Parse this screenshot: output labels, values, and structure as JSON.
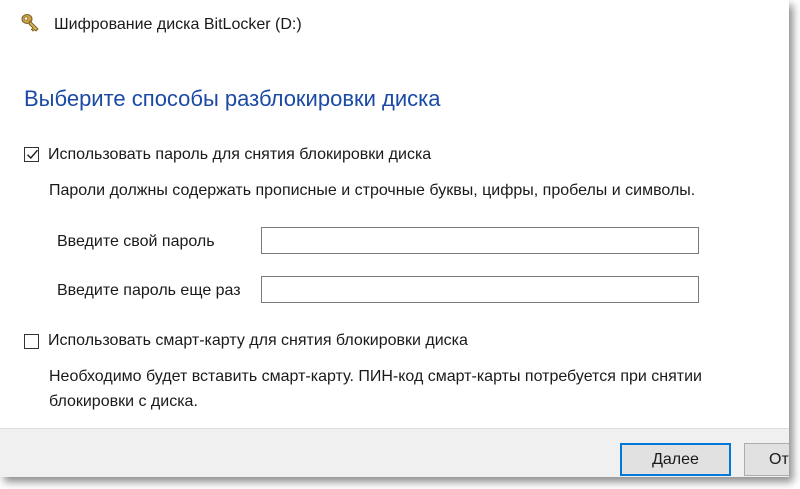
{
  "window": {
    "title": "Шифрование диска BitLocker (D:)",
    "icon": "bitlocker-key-icon"
  },
  "heading": "Выберите способы разблокировки диска",
  "password_option": {
    "checked": true,
    "label": "Использовать пароль для снятия блокировки диска",
    "description": "Пароли должны содержать прописные и строчные буквы, цифры, пробелы и символы.",
    "fields": [
      {
        "label": "Введите свой пароль",
        "value": ""
      },
      {
        "label": "Введите пароль еще раз",
        "value": ""
      }
    ]
  },
  "smartcard_option": {
    "checked": false,
    "label": "Использовать смарт-карту для снятия блокировки диска",
    "description_line1": "Необходимо будет вставить смарт-карту. ПИН-код смарт-карты потребуется при снятии",
    "description_line2": "блокировки с диска."
  },
  "footer": {
    "next_label": "Далее",
    "cancel_label_visible": "От"
  },
  "colors": {
    "heading": "#1b4aa5",
    "primary_border": "#0078d7",
    "footer_bg": "#f0f0f0"
  }
}
